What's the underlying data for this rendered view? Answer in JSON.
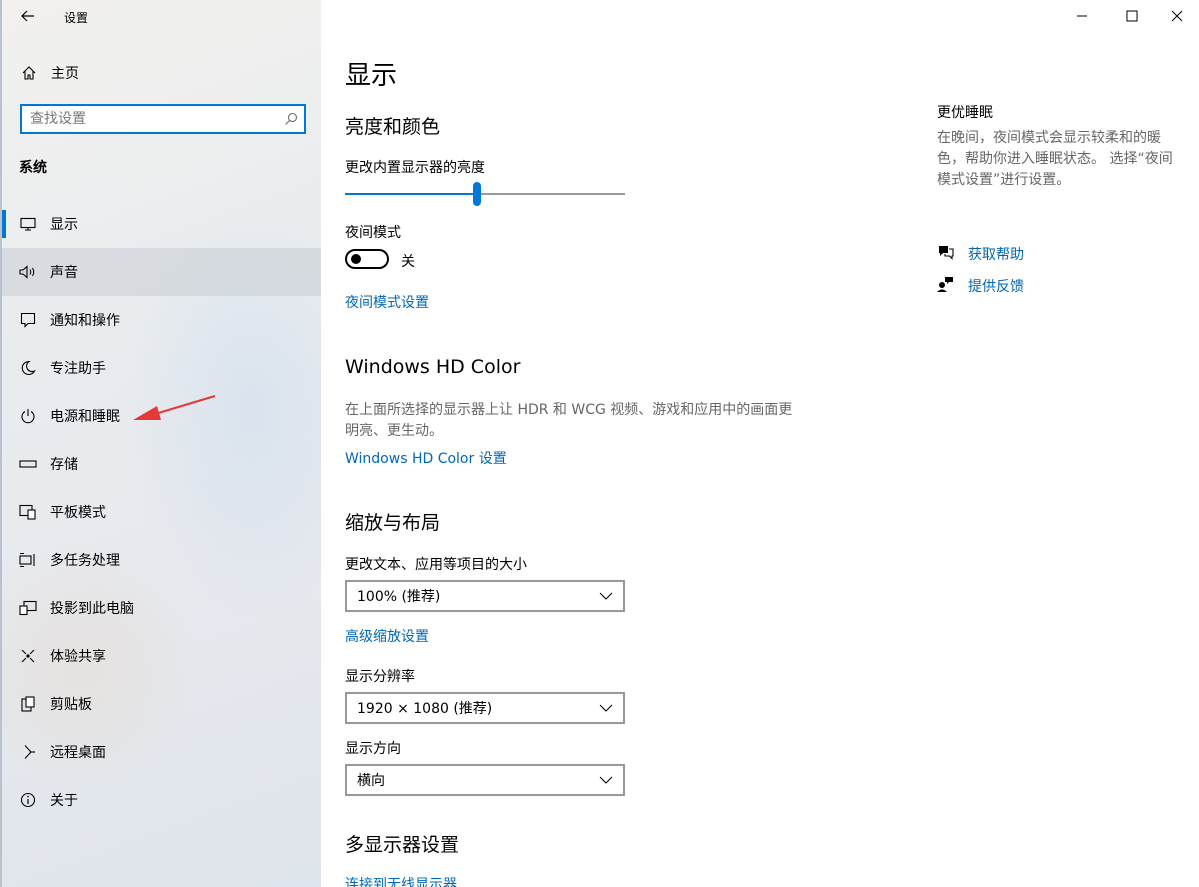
{
  "window": {
    "title": "设置"
  },
  "sidebar": {
    "home_label": "主页",
    "search_placeholder": "查找设置",
    "section_label": "系统",
    "items": [
      {
        "label": "显示",
        "icon": "monitor-icon",
        "selected": true
      },
      {
        "label": "声音",
        "icon": "speaker-icon",
        "hover": true
      },
      {
        "label": "通知和操作",
        "icon": "notification-icon"
      },
      {
        "label": "专注助手",
        "icon": "moon-icon"
      },
      {
        "label": "电源和睡眠",
        "icon": "power-icon"
      },
      {
        "label": "存储",
        "icon": "storage-icon"
      },
      {
        "label": "平板模式",
        "icon": "tablet-icon"
      },
      {
        "label": "多任务处理",
        "icon": "multitask-icon"
      },
      {
        "label": "投影到此电脑",
        "icon": "projector-icon"
      },
      {
        "label": "体验共享",
        "icon": "share-icon"
      },
      {
        "label": "剪贴板",
        "icon": "clipboard-icon"
      },
      {
        "label": "远程桌面",
        "icon": "remote-desktop-icon"
      },
      {
        "label": "关于",
        "icon": "info-icon"
      }
    ]
  },
  "main": {
    "page_title": "显示",
    "brightness_section": {
      "heading": "亮度和颜色",
      "slider_label": "更改内置显示器的亮度",
      "brightness_value": 0.47,
      "night_light_label": "夜间模式",
      "night_light_state": "关",
      "night_light_link": "夜间模式设置"
    },
    "hd_color": {
      "heading": "Windows HD Color",
      "description": "在上面所选择的显示器上让 HDR 和 WCG 视频、游戏和应用中的画面更明亮、更生动。",
      "link": "Windows HD Color 设置"
    },
    "scale_layout": {
      "heading": "缩放与布局",
      "scale_label": "更改文本、应用等项目的大小",
      "scale_value": "100% (推荐)",
      "advanced_link": "高级缩放设置",
      "resolution_label": "显示分辨率",
      "resolution_value": "1920 × 1080 (推荐)",
      "orientation_label": "显示方向",
      "orientation_value": "横向"
    },
    "multi_display": {
      "heading": "多显示器设置",
      "link": "连接到无线显示器"
    }
  },
  "right_panel": {
    "title": "更优睡眠",
    "description": "在晚间，夜间模式会显示较柔和的暖色，帮助你进入睡眠状态。 选择“夜间模式设置”进行设置。",
    "get_help": "获取帮助",
    "feedback": "提供反馈"
  },
  "colors": {
    "accent": "#0078d7",
    "link": "#0067b8",
    "annotation_arrow": "#e53935"
  }
}
